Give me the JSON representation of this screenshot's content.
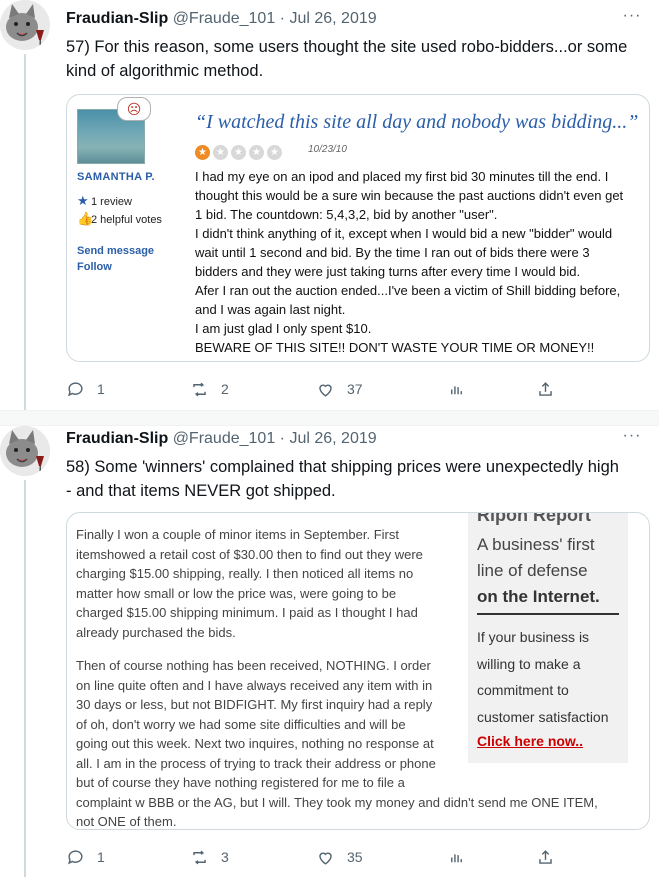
{
  "tweets": [
    {
      "name": "Fraudian-Slip",
      "handle": "@Fraude_101",
      "separator": "·",
      "date": "Jul 26, 2019",
      "more": "···",
      "text_lines": [
        "57) For this reason, some users thought the site used robo-bidders...or some",
        "kind of algorithmic method."
      ],
      "stats": {
        "replies": "1",
        "retweets": "2",
        "likes": "37"
      }
    },
    {
      "name": "Fraudian-Slip",
      "handle": "@Fraude_101",
      "separator": "·",
      "date": "Jul 26, 2019",
      "more": "···",
      "text_lines": [
        "58) Some 'winners' complained that shipping prices were unexpectedly high",
        "- and that items NEVER got shipped."
      ],
      "stats": {
        "replies": "1",
        "retweets": "3",
        "likes": "35"
      }
    }
  ],
  "review": {
    "user": "SAMANTHA P.",
    "reviews": "1 review",
    "helpful": "2 helpful votes",
    "send_message": "Send message",
    "follow": "Follow",
    "quote": "“I watched this site all day and nobody was bidding...”",
    "rating": 1,
    "rating_max": 5,
    "date": "10/23/10",
    "body_lines": [
      "I had my eye on an ipod and placed my first bid 30 minutes till the end. I",
      "thought this would be a sure win because the past auctions didn't even get",
      "1 bid. The countdown: 5,4,3,2, bid by another \"user\".",
      "I didn't think anything of it, except when I would bid a new \"bidder\" would",
      "wait until 1 second and bid. By the time I ran out of bids there were 3",
      "bidders and they were just taking turns after every time I would bid.",
      "Afer I ran out the auction ended...I've been a victim of Shill bidding before,",
      "and I was again last night.",
      "I am just glad I only spent $10.",
      "BEWARE OF THIS SITE!! DON'T WASTE YOUR TIME OR MONEY!!"
    ]
  },
  "complaint": {
    "para1": [
      "Finally I won a couple of minor items in September. First",
      "itemshowed a retail cost of $30.00 then to find out they were",
      "charging $15.00 shipping, really. I then noticed all items no",
      "matter how small or low the price was, were going to be",
      "charged $15.00 shipping minimum. I paid as I thought I had",
      "already purchased the bids."
    ],
    "para2": [
      "Then of course nothing has been received, NOTHING. I order",
      "on line quite often and I have always received any item with in",
      "30 days or less, but not BIDFIGHT. My first inquiry had a reply",
      "of oh, don't worry we had some site difficulties and will be",
      "going out this week. Next two inquires, nothing no response at",
      "all. I am in the process of trying to track their address or phone",
      "but of course they have nothing registered for me to file a",
      "complaint w BBB or the AG, but I will. They took my money and didn't send me ONE ITEM,",
      "not ONE of them."
    ],
    "side": {
      "head": "Ripon Report",
      "tag1": "A business' first",
      "tag2": "line of defense",
      "tag3": "on the Internet.",
      "pitch": [
        "If your business is",
        "willing to make a",
        "commitment to",
        "customer satisfaction"
      ],
      "cta": "Click here now.."
    }
  }
}
